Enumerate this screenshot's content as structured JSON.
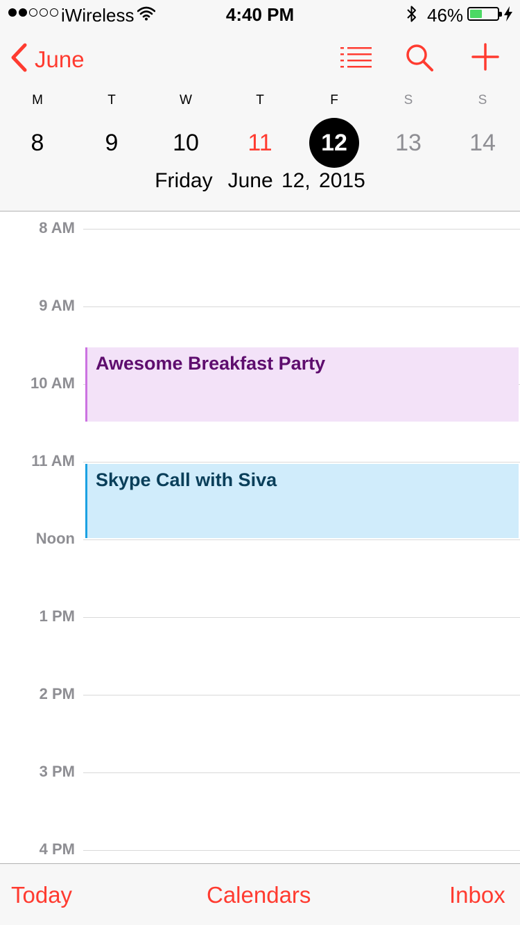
{
  "status_bar": {
    "carrier": "iWireless",
    "time": "4:40 PM",
    "battery_percent": "46%",
    "battery_level": 0.46,
    "signal_strength": 2,
    "signal_max": 5
  },
  "nav": {
    "back_label": "June",
    "icons": [
      "chevron-left-icon",
      "list-icon",
      "search-icon",
      "plus-icon"
    ],
    "accent_color": "#ff3b30"
  },
  "week": {
    "days": [
      {
        "weekday": "M",
        "number": "8"
      },
      {
        "weekday": "T",
        "number": "9"
      },
      {
        "weekday": "W",
        "number": "10"
      },
      {
        "weekday": "T",
        "number": "11"
      },
      {
        "weekday": "F",
        "number": "12"
      },
      {
        "weekday": "S",
        "number": "13"
      },
      {
        "weekday": "S",
        "number": "14"
      }
    ],
    "selected_day": "12",
    "current_day": "11"
  },
  "selected_date": {
    "weekday": "Friday",
    "date": "June 12, 2015"
  },
  "timeline": {
    "hours": [
      "8 AM",
      "9 AM",
      "10 AM",
      "11 AM",
      "Noon",
      "1 PM",
      "2 PM",
      "3 PM",
      "4 PM"
    ],
    "events": [
      {
        "title": "Awesome Breakfast Party",
        "color": "#cc73e1"
      },
      {
        "title": "Skype Call with Siva",
        "color": "#1ba1e2"
      }
    ]
  },
  "tab_bar": {
    "today": "Today",
    "calendars": "Calendars",
    "inbox": "Inbox"
  }
}
